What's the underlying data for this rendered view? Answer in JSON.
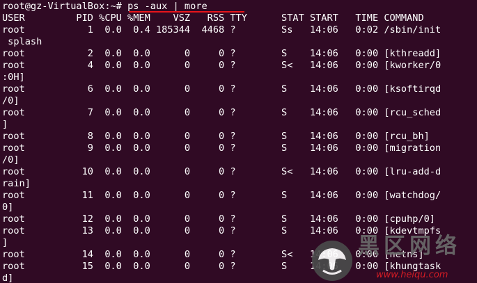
{
  "terminal": {
    "prompt": "root@gz-VirtualBox:~# ",
    "command": "ps -aux | more",
    "lines": [
      "USER         PID %CPU %MEM    VSZ   RSS TTY      STAT START   TIME COMMAND",
      "root           1  0.0  0.4 185344  4468 ?        Ss   14:06   0:02 /sbin/init",
      " splash",
      "root           2  0.0  0.0      0     0 ?        S    14:06   0:00 [kthreadd]",
      "root           4  0.0  0.0      0     0 ?        S<   14:06   0:00 [kworker/0",
      ":0H]",
      "root           6  0.0  0.0      0     0 ?        S    14:06   0:00 [ksoftirqd",
      "/0]",
      "root           7  0.0  0.0      0     0 ?        S    14:06   0:00 [rcu_sched",
      "]",
      "root           8  0.0  0.0      0     0 ?        S    14:06   0:00 [rcu_bh]",
      "root           9  0.0  0.0      0     0 ?        S    14:06   0:00 [migration",
      "/0]",
      "root          10  0.0  0.0      0     0 ?        S<   14:06   0:00 [lru-add-d",
      "rain]",
      "root          11  0.0  0.0      0     0 ?        S    14:06   0:00 [watchdog/",
      "0]",
      "root          12  0.0  0.0      0     0 ?        S    14:06   0:00 [cpuhp/0]",
      "root          13  0.0  0.0      0     0 ?        S    14:06   0:00 [kdevtmpfs",
      "]",
      "root          14  0.0  0.0      0     0 ?        S<   14:06   0:00 [netns]",
      "root          15  0.0  0.0      0     0 ?        S    14:06   0:00 [khungtask",
      "d]"
    ]
  },
  "watermark": {
    "brand": "黑区网络",
    "site": "www.heiqu.com"
  },
  "colors": {
    "background": "#300a24",
    "text": "#ffffff",
    "annotation": "#e8151b"
  }
}
